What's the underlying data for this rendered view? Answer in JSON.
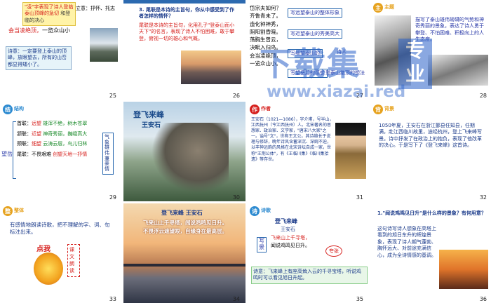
{
  "slides": [
    {
      "num": "25",
      "l1": "\"凌\"字表现了诗人登临泰山顶峰的急切",
      "l2": "和登临的决心",
      "a": "立意：",
      "b": "抒怀、托志",
      "c": "会当凌绝顶，",
      "d": "一览众山小",
      "note": "诗意：一定要登上泰山的顶峰，放眼望去，所有的山峦都显得",
      "e": "矮小了。"
    },
    {
      "num": "26",
      "q": "3. 尾联是本诗的主旨句，你从中感受到了作者怎样的情怀？",
      "a": "尾联是本诗的主旨句，化用孔子\"登泰山而小天下\"的名言，表现了诗人不怕困难，敢于攀登，俯视一切的雄心和气概。"
    },
    {
      "num": "27",
      "lines": [
        "岱宗夫如何？",
        "齐鲁青未了。",
        "造化钟神秀，",
        "阴阳割昏晓。",
        "荡胸生曾云，",
        "决眦入归鸟。",
        "会当凌绝顶，",
        "一览众山小。"
      ],
      "boxes": [
        "写远望泰山的整体形象",
        "写近望泰山的秀美高大",
        "写细望泰山的",
        "写望岳后的感想",
        "诗人",
        "登泰山绝顶的想法"
      ]
    },
    {
      "num": "28",
      "tag": "主题",
      "t": "描写了泰山雄伟磅礴的气势和神奇秀丽的景象，表达了诗人勇于攀登、不怕困难、积极向上的人生态度。"
    },
    {
      "num": "29",
      "tag": "结构",
      "rows": [
        [
          "首联：",
          "远望",
          "雄浑不绝，树木苍翠"
        ],
        [
          "颔联：",
          "近望",
          "神奇秀丽，巍峨高大"
        ],
        [
          "颈联：",
          "细望",
          "云涛云层，鸟儿归林"
        ],
        [
          "尾联：",
          "不畏艰难",
          "创望天地一抒情"
        ]
      ],
      "left": "望岳",
      "right": "气象雄伟兼豪情"
    },
    {
      "num": "30",
      "title1": "登飞来峰",
      "title2": "王安石"
    },
    {
      "num": "31",
      "tag": "作者",
      "txt": "王安石（1021—1086），字介甫，号半山，江西抚州（今江西抚州）人。北宋著名的思想家、政治家、文学家，\"唐宋八大家\"之一。谥号\"文\"，世称王文公。其诗雄长于说理与修辞，晚年诗风含蓄深沉、深婉不迫，以丰神远韵的风格在北宋诗坛自成一家，世称\"王荆公体\"，有《王临川集》《临川集拾遗》等存世。"
    },
    {
      "num": "32",
      "tag": "背景",
      "txt": "1050年夏，王安石在浙江鄞县任知县，任期满，赴江西临川故里，途经杭州，登上飞来峰写景。诗中抒发了在政治上的抱负，表现了他改革的决心。于是写下了《登飞来峰》这首诗。"
    },
    {
      "num": "33",
      "tag": "整体",
      "txt": "有感情地朗读诗歌，把不理解的字、词、句标注出来。",
      "stamp": "点我",
      "side": [
        "课",
        "文",
        "朗",
        "读"
      ]
    },
    {
      "num": "34",
      "title": "登飞来峰  王安石",
      "lines": [
        "飞来山上千寻塔，闻说鸡鸣见日升。",
        "不畏浮云遮望眼，自缘身在最高层。"
      ]
    },
    {
      "num": "35",
      "tag": "诗歌",
      "p1": "登飞来峰",
      "p2": "王安石",
      "p3": "飞来山上千寻塔，",
      "p4": "闻说鸡鸣见日升。",
      "lbl": "写景",
      "lbl2": "夸张",
      "note": "诗意：飞来峰上有座高耸入云的千寻宝塔，听说鸡鸣时可以看见旭日升起。"
    },
    {
      "num": "36",
      "q": "1.\"闻说鸡鸣见日升\"是什么样的景象？有何用意？",
      "a": "这句诗写诗人想象在高塔上看到的旭日东升的辉煌景象，表现了诗人朝气蓬勃、胸怀远大、对前途充满信心，成为全诗情感的基调。"
    }
  ],
  "watermark": {
    "main": "下载集",
    "url": "www.xiazai.red",
    "badge": "专业"
  },
  "colors": {
    "accent": "#2c6ab0",
    "red": "#d6201d"
  }
}
